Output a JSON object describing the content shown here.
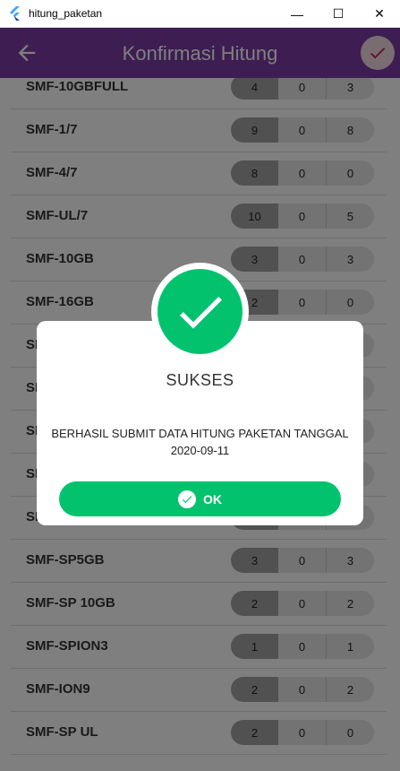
{
  "window": {
    "title": "hitung_paketan",
    "minimize": "—",
    "maximize": "☐",
    "close": "✕"
  },
  "appbar": {
    "title": "Konfirmasi Hitung",
    "back_icon": "back-arrow-icon",
    "confirm_icon": "check-icon"
  },
  "colors": {
    "primary": "#7b3aa5",
    "success": "#03c26e",
    "confirm_bg": "#f0dde3",
    "confirm_check": "#c2185b"
  },
  "rows": [
    {
      "label": "SMF-10GBFULL",
      "values": [
        "4",
        "0",
        "3"
      ]
    },
    {
      "label": "SMF-1/7",
      "values": [
        "9",
        "0",
        "8"
      ]
    },
    {
      "label": "SMF-4/7",
      "values": [
        "8",
        "0",
        "0"
      ]
    },
    {
      "label": "SMF-UL/7",
      "values": [
        "10",
        "0",
        "5"
      ]
    },
    {
      "label": "SMF-10GB",
      "values": [
        "3",
        "0",
        "3"
      ]
    },
    {
      "label": "SMF-16GB",
      "values": [
        "2",
        "0",
        "0"
      ]
    },
    {
      "label": "SM",
      "values": [
        "",
        "",
        ""
      ]
    },
    {
      "label": "SM",
      "values": [
        "",
        "",
        ""
      ]
    },
    {
      "label": "SM",
      "values": [
        "",
        "",
        ""
      ]
    },
    {
      "label": "SM",
      "values": [
        "",
        "",
        ""
      ]
    },
    {
      "label": "SM",
      "values": [
        "",
        "",
        ""
      ]
    },
    {
      "label": "SMF-SP5GB",
      "values": [
        "3",
        "0",
        "3"
      ]
    },
    {
      "label": "SMF-SP 10GB",
      "values": [
        "2",
        "0",
        "2"
      ]
    },
    {
      "label": "SMF-SPION3",
      "values": [
        "1",
        "0",
        "1"
      ]
    },
    {
      "label": "SMF-ION9",
      "values": [
        "2",
        "0",
        "2"
      ]
    },
    {
      "label": "SMF-SP UL",
      "values": [
        "2",
        "0",
        "0"
      ]
    }
  ],
  "dialog": {
    "icon": "success-check-icon",
    "title": "SUKSES",
    "message": "BERHASIL SUBMIT DATA HITUNG PAKETAN TANGGAL 2020-09-11",
    "ok_label": "OK"
  }
}
